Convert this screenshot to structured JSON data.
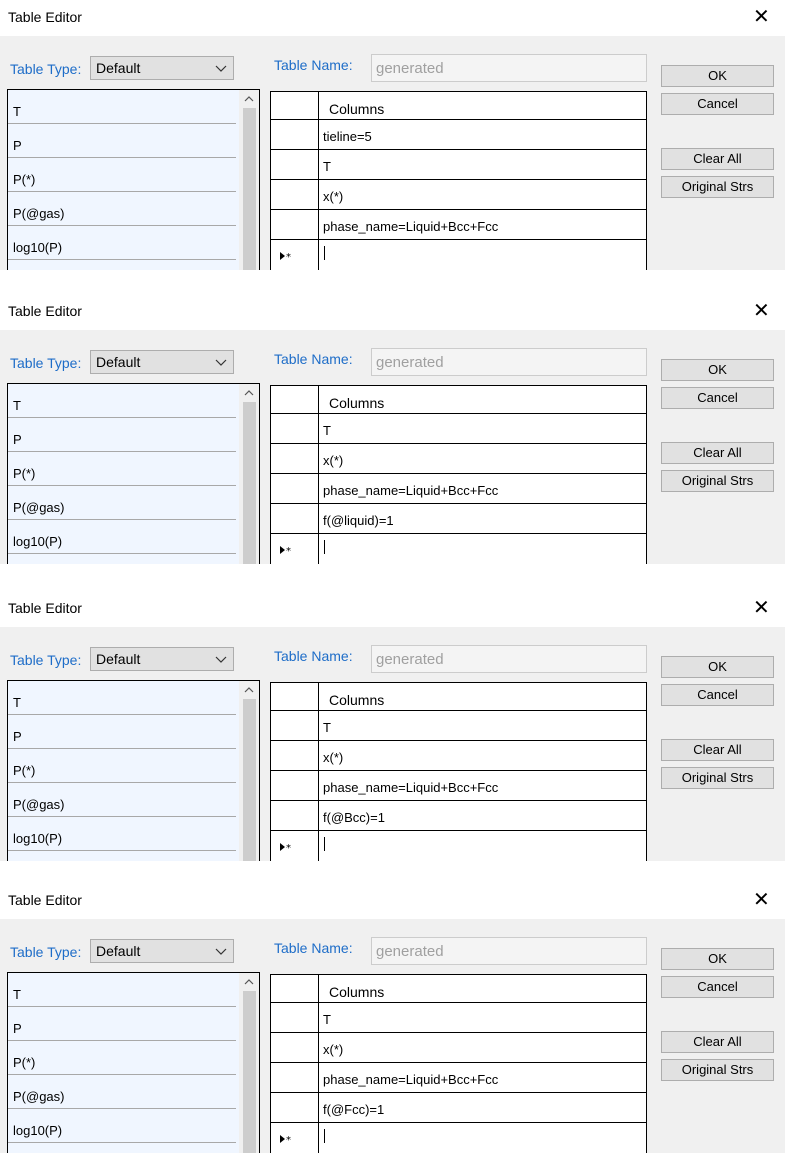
{
  "dialogs": [
    {
      "title": "Table Editor",
      "table_type_label": "Table Type:",
      "table_type_value": "Default",
      "table_name_label": "Table Name:",
      "table_name_value": "generated",
      "buttons": {
        "ok": "OK",
        "cancel": "Cancel",
        "clear_all": "Clear All",
        "original_strs": "Original Strs"
      },
      "variables": [
        "T",
        "P",
        "P(*)",
        "P(@gas)",
        "log10(P)"
      ],
      "columns_header": "Columns",
      "columns": [
        "tieline=5",
        "T",
        "x(*)",
        "phase_name=Liquid+Bcc+Fcc"
      ]
    },
    {
      "title": "Table Editor",
      "table_type_label": "Table Type:",
      "table_type_value": "Default",
      "table_name_label": "Table Name:",
      "table_name_value": "generated",
      "buttons": {
        "ok": "OK",
        "cancel": "Cancel",
        "clear_all": "Clear All",
        "original_strs": "Original Strs"
      },
      "variables": [
        "T",
        "P",
        "P(*)",
        "P(@gas)",
        "log10(P)"
      ],
      "columns_header": "Columns",
      "columns": [
        "T",
        "x(*)",
        "phase_name=Liquid+Bcc+Fcc",
        "f(@liquid)=1"
      ]
    },
    {
      "title": "Table Editor",
      "table_type_label": "Table Type:",
      "table_type_value": "Default",
      "table_name_label": "Table Name:",
      "table_name_value": "generated",
      "buttons": {
        "ok": "OK",
        "cancel": "Cancel",
        "clear_all": "Clear All",
        "original_strs": "Original Strs"
      },
      "variables": [
        "T",
        "P",
        "P(*)",
        "P(@gas)",
        "log10(P)"
      ],
      "columns_header": "Columns",
      "columns": [
        "T",
        "x(*)",
        "phase_name=Liquid+Bcc+Fcc",
        "f(@Bcc)=1"
      ]
    },
    {
      "title": "Table Editor",
      "table_type_label": "Table Type:",
      "table_type_value": "Default",
      "table_name_label": "Table Name:",
      "table_name_value": "generated",
      "buttons": {
        "ok": "OK",
        "cancel": "Cancel",
        "clear_all": "Clear All",
        "original_strs": "Original Strs"
      },
      "variables": [
        "T",
        "P",
        "P(*)",
        "P(@gas)",
        "log10(P)"
      ],
      "columns_header": "Columns",
      "columns": [
        "T",
        "x(*)",
        "phase_name=Liquid+Bcc+Fcc",
        "f(@Fcc)=1"
      ]
    }
  ],
  "icons": {
    "close": "close-icon",
    "dropdown": "chevron-down-icon",
    "scroll_up": "scroll-up-icon",
    "new_row": "new-row-icon"
  },
  "colors": {
    "label_blue": "#1e6dc8",
    "list_background": "#f0f6ff",
    "dialog_background": "#f0f0f0",
    "button_face": "#e1e1e1"
  }
}
